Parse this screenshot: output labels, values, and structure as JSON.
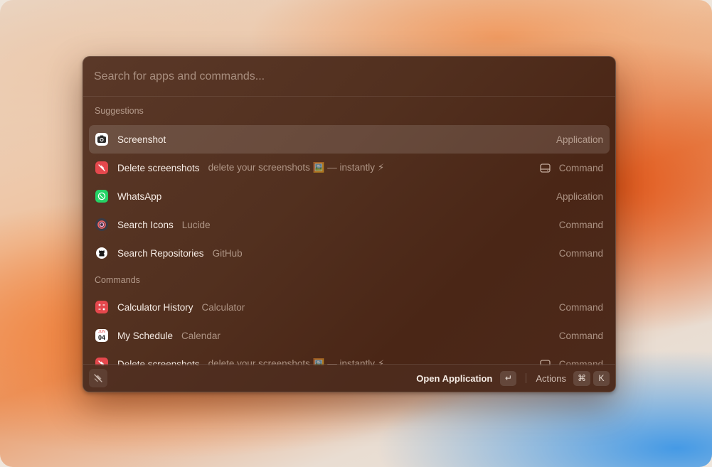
{
  "search": {
    "placeholder": "Search for apps and commands..."
  },
  "sections": [
    {
      "title": "Suggestions",
      "items": [
        {
          "icon": "screenshot-app-icon",
          "title": "Screenshot",
          "subtitle": "",
          "type": "Application",
          "selected": true
        },
        {
          "icon": "delete-screenshots-icon",
          "title": "Delete screenshots",
          "subtitle": "delete your screenshots 🖼️ — instantly ⚡",
          "type": "Command",
          "accessory": "drive-icon"
        },
        {
          "icon": "whatsapp-icon",
          "title": "WhatsApp",
          "subtitle": "",
          "type": "Application"
        },
        {
          "icon": "lucide-icon",
          "title": "Search Icons",
          "subtitle": "Lucide",
          "type": "Command"
        },
        {
          "icon": "github-icon",
          "title": "Search Repositories",
          "subtitle": "GitHub",
          "type": "Command"
        }
      ]
    },
    {
      "title": "Commands",
      "items": [
        {
          "icon": "calculator-icon",
          "title": "Calculator History",
          "subtitle": "Calculator",
          "type": "Command"
        },
        {
          "icon": "calendar-icon",
          "title": "My Schedule",
          "subtitle": "Calendar",
          "type": "Command",
          "calendar_month": "JUN",
          "calendar_day": "04"
        },
        {
          "icon": "delete-screenshots-icon",
          "title": "Delete screenshots",
          "subtitle": "delete your screenshots 🖼️ — instantly ⚡",
          "type": "Command",
          "accessory": "drive-icon"
        }
      ]
    }
  ],
  "footer": {
    "primary_action": "Open Application",
    "primary_key": "↵",
    "actions_label": "Actions",
    "actions_keys": [
      "⌘",
      "K"
    ]
  },
  "colors": {
    "window_bg": "#52301f",
    "red_icon": "#e5484d",
    "whatsapp_green": "#25d366"
  }
}
